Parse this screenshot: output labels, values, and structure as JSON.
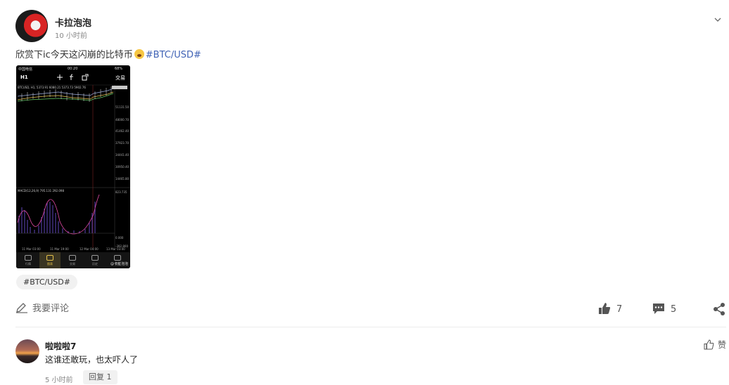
{
  "post": {
    "author": "卡拉泡泡",
    "time": "10 小时前",
    "text": "欣赏下ic今天这闪崩的比特币",
    "hashtag": "#BTC/USD#",
    "tag_chip": "#BTC/USD#"
  },
  "screenshot": {
    "status_left": "中国电信",
    "status_time": "00:20",
    "status_battery": "68%",
    "timeframe": "H1",
    "trade_label": "交易",
    "info_line": "BTCUSD, H1, 5373.91 6080.21 5373.73 5902.76",
    "macd_line": "MACD(12,26,9) 795.131 292.098",
    "price_labels": [
      "5902.76",
      "51131.50",
      "48000.70",
      "41462.40",
      "37923.70",
      "34441.40",
      "30950.40",
      "14465.80"
    ],
    "macd_labels": [
      "823.735",
      "0.000",
      "-392.800"
    ],
    "x_labels": [
      "11 Mar 03:00",
      "11 Mar 19:00",
      "12 Mar 04:00",
      "13 Mar 03:00"
    ],
    "tabs": [
      "行情",
      "图表",
      "交易",
      "历史",
      "设置"
    ],
    "watermark": "@卡拉泡泡"
  },
  "actions": {
    "comment_prompt": "我要评论",
    "likes": "7",
    "comments": "5"
  },
  "comment": {
    "author": "啦啦啦7",
    "text": "这谁还敢玩，也太吓人了",
    "time": "5 小时前",
    "reply": "回复 1",
    "like": "赞"
  },
  "colors": {
    "hashtag": "#3f62b5",
    "chart_bg": "#000000",
    "active_tab": "#e6c24a"
  }
}
